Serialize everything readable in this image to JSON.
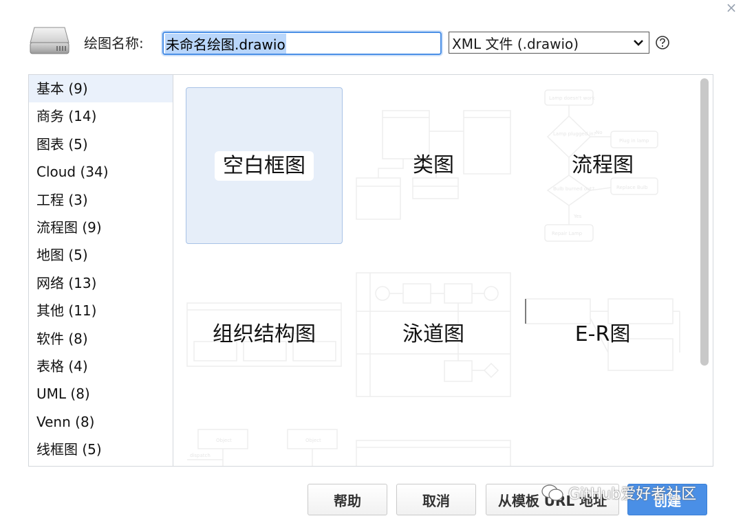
{
  "header": {
    "name_label": "绘图名称:",
    "filename_value": "未命名绘图.drawio",
    "format_selected": "XML 文件 (.drawio)",
    "icons": {
      "drive": "hard-drive-icon",
      "format_dropdown": "chevron-down-icon",
      "help": "help-circle-icon",
      "close": "close-icon"
    }
  },
  "close_glyph": "×",
  "categories": [
    "基本 (9)",
    "商务 (14)",
    "图表 (5)",
    "Cloud (34)",
    "工程 (3)",
    "流程图 (9)",
    "地图 (5)",
    "网络 (13)",
    "其他 (11)",
    "软件 (8)",
    "表格 (4)",
    "UML (8)",
    "Venn (8)",
    "线框图 (5)"
  ],
  "active_category_index": 0,
  "templates": [
    {
      "label": "空白框图",
      "selected": true
    },
    {
      "label": "类图",
      "selected": false
    },
    {
      "label": "流程图",
      "selected": false
    },
    {
      "label": "组织结构图",
      "selected": false
    },
    {
      "label": "泳道图",
      "selected": false
    },
    {
      "label": "E-R图",
      "selected": false
    }
  ],
  "preview_text": {
    "flow_lamp": "Lamp doesn't work",
    "flow_plugged": "Lamp plugged in?",
    "flow_plug": "Plug in lamp",
    "flow_bulb": "Bulb burned out?",
    "flow_replace": "Replace Bulb",
    "flow_repair": "Repair Lamp",
    "flow_no": "No",
    "flow_yes": "Yes",
    "object1": "Object",
    "object2": "Object",
    "dispatch": "dispatch"
  },
  "buttons": {
    "help": "帮助",
    "cancel": "取消",
    "from_url": "从模板 URL 地址",
    "create": "创建"
  },
  "watermark": "GitHub爱好者社区",
  "colors": {
    "accent": "#4a8fe6",
    "selected_tile": "#e6eef9",
    "active_category": "#eaf1fb"
  }
}
